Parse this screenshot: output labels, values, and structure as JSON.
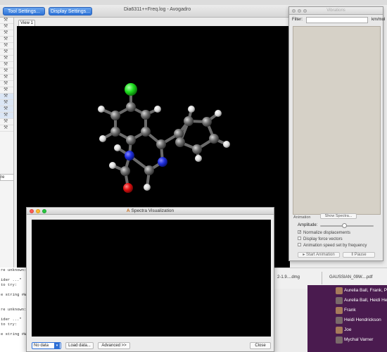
{
  "window": {
    "title": "Dia6311++Freq.log - Avogadro",
    "tool_settings": "Tool Settings...",
    "display_settings": "Display Settings...",
    "view_tab": "View 1"
  },
  "left_panel": {
    "truncated_label": "re"
  },
  "terminal": {
    "lines": [
      "re unknown:",
      "",
      "ider ...\"",
      " to try:",
      "",
      "e string #W",
      "",
      "",
      "re unknown:",
      "",
      "ider ...\"",
      " to try:",
      "",
      "e string #W"
    ]
  },
  "downloads": {
    "item1": "2-1.9....dmg",
    "item2": "GAUSSIAN_09W....pdf"
  },
  "chat": {
    "rows": [
      "Aurelia Ball, Frank, Pa",
      "Aurelia Ball, Heidi He",
      "Frank",
      "Heidi Hendrickson",
      "Joe",
      "Mychal Varner"
    ]
  },
  "vibrations": {
    "title": "Vibrations",
    "filter_label": "Filter:",
    "unit": "km/mol",
    "animation_label": "Animation",
    "show_spectra": "Show Spectra...",
    "amplitude_label": "Amplitude:",
    "amplitude_fraction": 0.45,
    "options": [
      {
        "label": "Normalize displacements",
        "checked": true
      },
      {
        "label": "Display force vectors",
        "checked": false
      },
      {
        "label": "Animation speed set by frequency",
        "checked": false
      }
    ],
    "start_animation": "Start Animation",
    "pause": "Pause"
  },
  "spectra": {
    "title": "Spectra Visualization",
    "select_value": "No data",
    "load_data": "Load data...",
    "advanced": "Advanced >>",
    "close": "Close"
  },
  "molecule": {
    "atom_colors": {
      "carbon": "#6e6e6e",
      "hydrogen": "#e8e8e8",
      "nitrogen": "#1f2fe0",
      "oxygen": "#e01010",
      "chlorine": "#1fe01f"
    }
  }
}
